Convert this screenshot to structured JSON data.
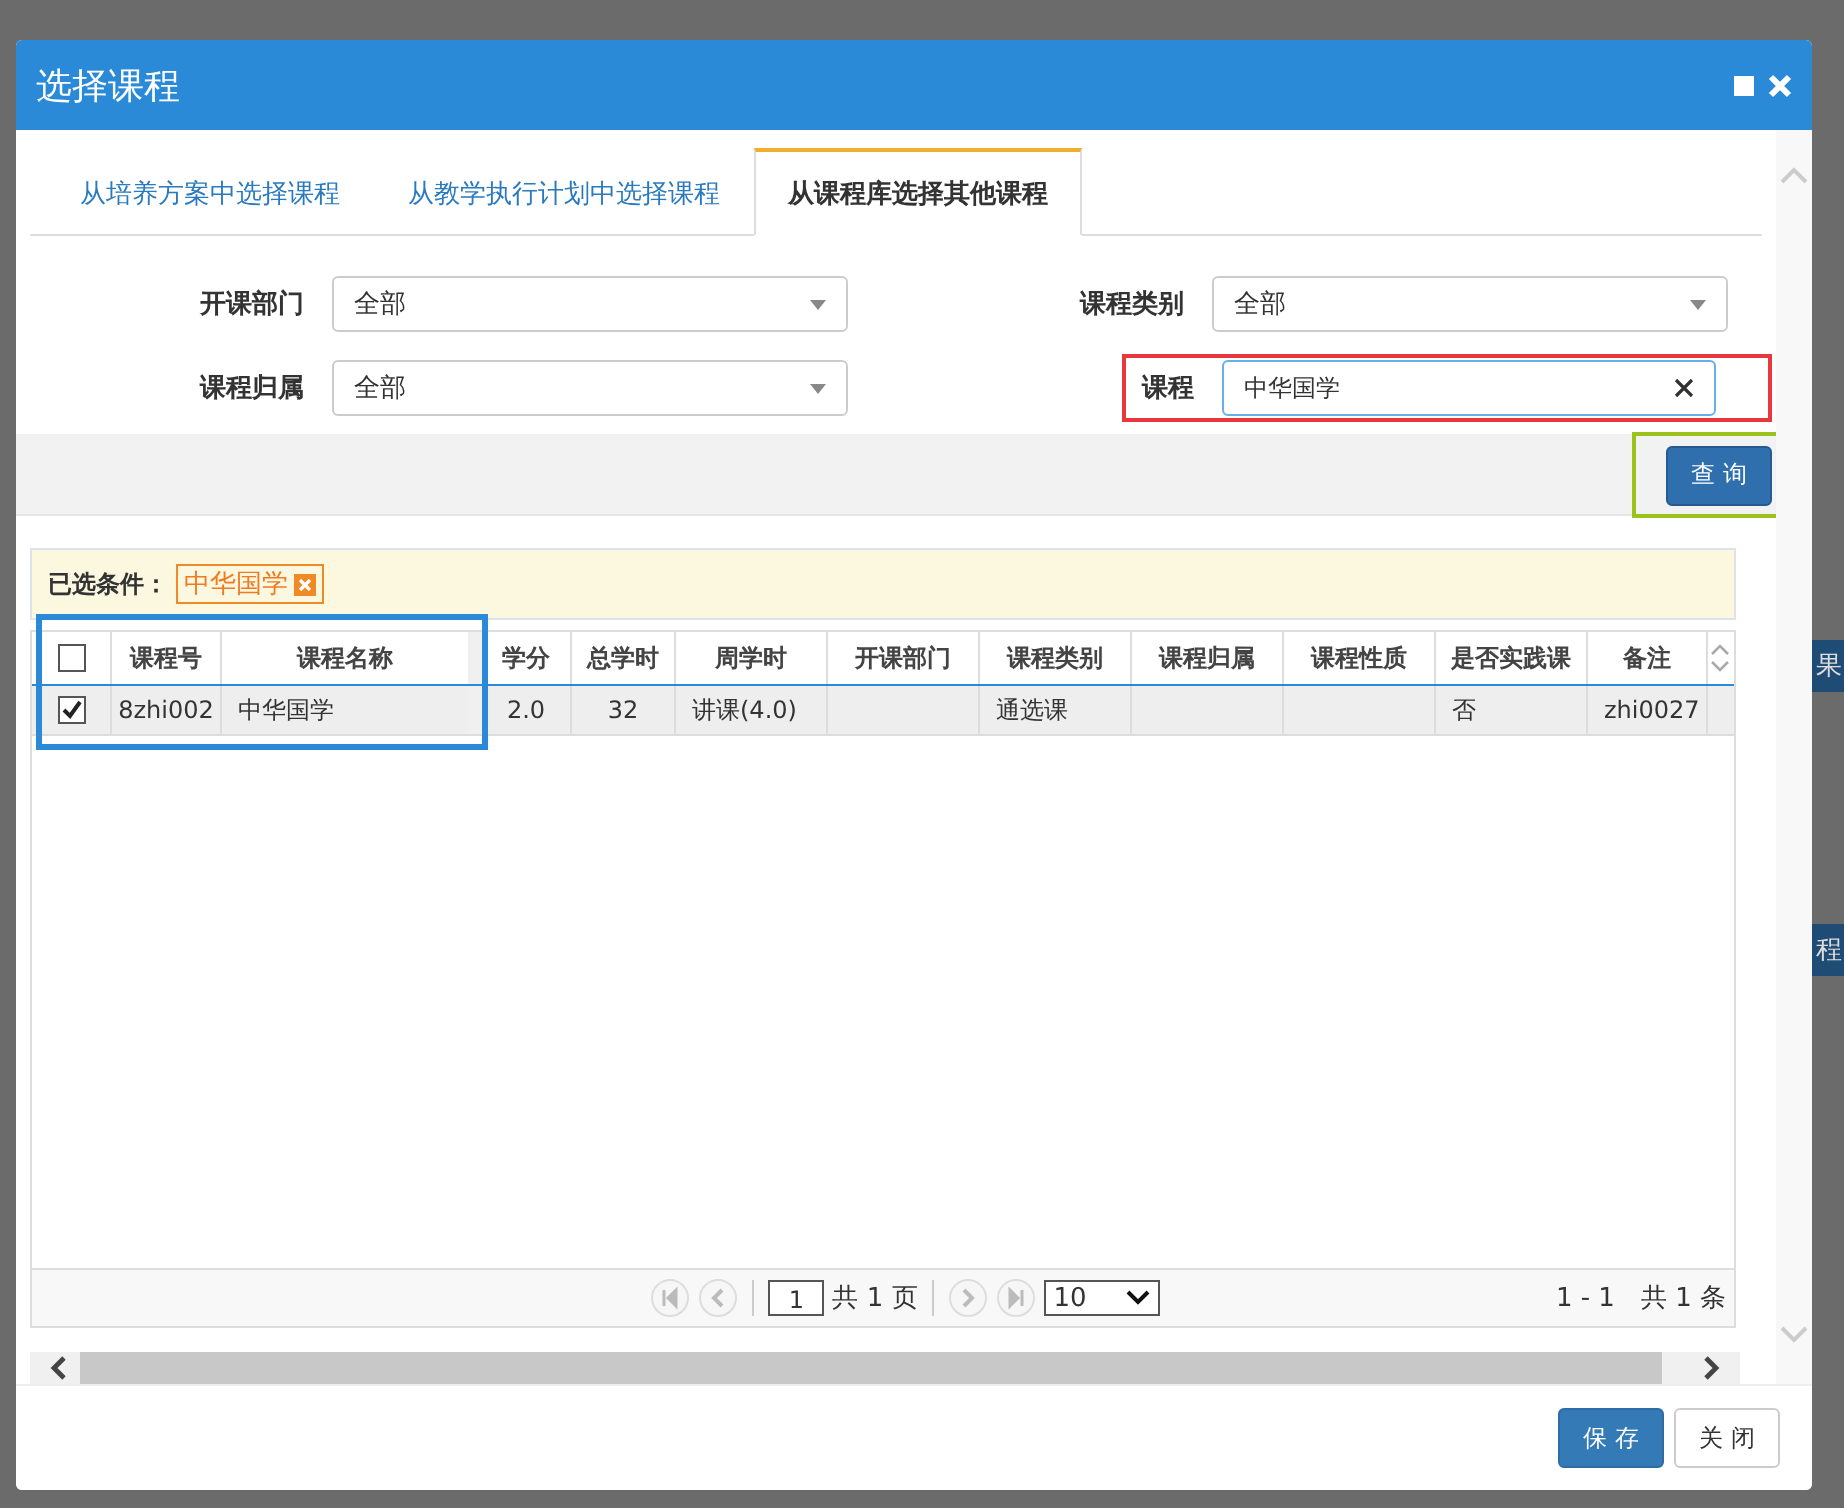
{
  "window": {
    "title": "选择课程"
  },
  "tabs": [
    {
      "label": "从培养方案中选择课程",
      "selected": false
    },
    {
      "label": "从教学执行计划中选择课程",
      "selected": false
    },
    {
      "label": "从课程库选择其他课程",
      "selected": true
    }
  ],
  "filters": [
    {
      "label": "开课部门",
      "kind": "select",
      "value": "全部",
      "highlighted": false
    },
    {
      "label": "课程类别",
      "kind": "select",
      "value": "全部",
      "highlighted": false
    },
    {
      "label": "课程归属",
      "kind": "select",
      "value": "全部",
      "highlighted": false
    },
    {
      "label": "课程",
      "kind": "text",
      "value": "中华国学",
      "highlighted": true
    }
  ],
  "query_button": {
    "label": "查 询",
    "highlighted": true
  },
  "selected_conditions": {
    "label": "已选条件：",
    "tags": [
      "中华国学"
    ]
  },
  "table": {
    "columns": [
      "课程号",
      "课程名称",
      "学分",
      "总学时",
      "周学时",
      "开课部门",
      "课程类别",
      "课程归属",
      "课程性质",
      "是否实践课",
      "备注"
    ],
    "header_checked": false,
    "rows": [
      {
        "checked": true,
        "cells": [
          "8zhi002",
          "中华国学",
          "2.0",
          "32",
          "讲课(4.0)",
          "",
          "通选课",
          "",
          "",
          "否",
          "zhi0027"
        ]
      }
    ]
  },
  "pager": {
    "page": "1",
    "pages_text": "共 1 页",
    "page_size": "10",
    "summary": "1 - 1　共 1 条"
  },
  "buttons": [
    {
      "label": "保 存",
      "kind": "primary"
    },
    {
      "label": "关 闭",
      "kind": "default"
    }
  ],
  "background": {
    "fragments": [
      "果",
      "程"
    ]
  }
}
